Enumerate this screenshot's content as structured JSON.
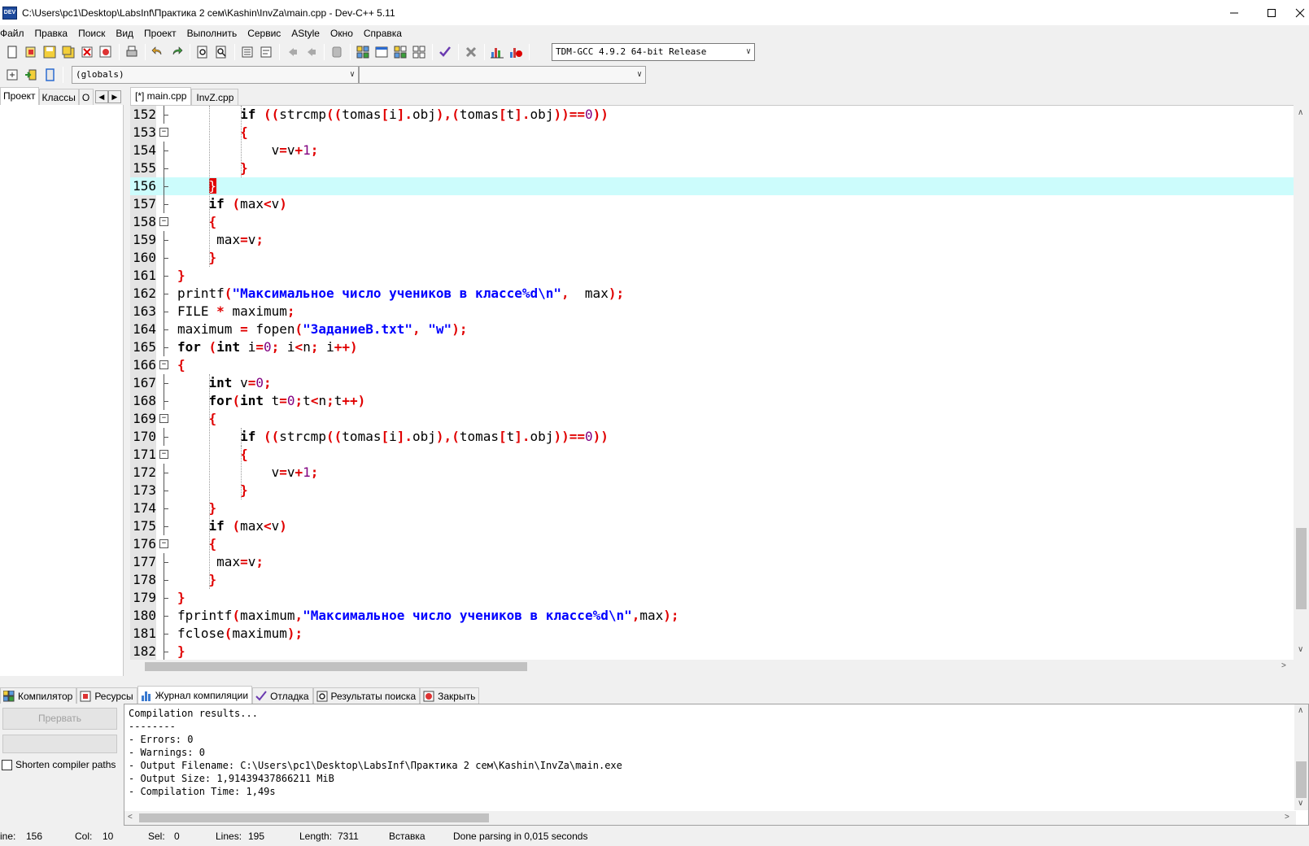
{
  "window": {
    "title": "C:\\Users\\pc1\\Desktop\\LabsInf\\Практика 2 сем\\Kashin\\InvZa\\main.cpp - Dev-C++ 5.11",
    "icon_label": "DEV"
  },
  "menu": [
    "Файл",
    "Правка",
    "Поиск",
    "Вид",
    "Проект",
    "Выполнить",
    "Сервис",
    "AStyle",
    "Окно",
    "Справка"
  ],
  "toolbar": {
    "compiler": "TDM-GCC 4.9.2 64-bit Release",
    "scope_combo": "(globals)",
    "member_combo": ""
  },
  "left_tabs": [
    "Проект",
    "Классы",
    "О"
  ],
  "editor_tabs": [
    "[*] main.cpp",
    "InvZ.cpp"
  ],
  "colors": {
    "keyword": "#000000",
    "symbol": "#e00000",
    "number": "#800080",
    "string": "#0000ff",
    "current_line": "#ccfcfc"
  },
  "code": {
    "current_line": 156,
    "lines": [
      {
        "n": "152",
        "tokens": [
          [
            "ws",
            "        "
          ],
          [
            "kw",
            "if"
          ],
          [
            "ws",
            " "
          ],
          [
            "sym",
            "(("
          ],
          [
            "id",
            "strcmp"
          ],
          [
            "sym",
            "(("
          ],
          [
            "id",
            "tomas"
          ],
          [
            "sym",
            "["
          ],
          [
            "id",
            "i"
          ],
          [
            "sym",
            "]."
          ],
          [
            "id",
            "obj"
          ],
          [
            "sym",
            "),("
          ],
          [
            "id",
            "tomas"
          ],
          [
            "sym",
            "["
          ],
          [
            "id",
            "t"
          ],
          [
            "sym",
            "]."
          ],
          [
            "id",
            "obj"
          ],
          [
            "sym",
            "))=="
          ],
          [
            "num",
            "0"
          ],
          [
            "sym",
            "))"
          ]
        ]
      },
      {
        "n": "153",
        "tokens": [
          [
            "ws",
            "        "
          ],
          [
            "sym",
            "{"
          ]
        ]
      },
      {
        "n": "154",
        "tokens": [
          [
            "ws",
            "            "
          ],
          [
            "id",
            "v"
          ],
          [
            "sym",
            "="
          ],
          [
            "id",
            "v"
          ],
          [
            "sym",
            "+"
          ],
          [
            "num",
            "1"
          ],
          [
            "sym",
            ";"
          ]
        ]
      },
      {
        "n": "155",
        "tokens": [
          [
            "ws",
            "        "
          ],
          [
            "sym",
            "}"
          ]
        ]
      },
      {
        "n": "156",
        "tokens": [
          [
            "ws",
            "    "
          ],
          [
            "caret",
            "}"
          ]
        ]
      },
      {
        "n": "157",
        "tokens": [
          [
            "ws",
            "    "
          ],
          [
            "kw",
            "if"
          ],
          [
            "ws",
            " "
          ],
          [
            "sym",
            "("
          ],
          [
            "id",
            "max"
          ],
          [
            "sym",
            "<"
          ],
          [
            "id",
            "v"
          ],
          [
            "sym",
            ")"
          ]
        ]
      },
      {
        "n": "158",
        "tokens": [
          [
            "ws",
            "    "
          ],
          [
            "sym",
            "{"
          ]
        ]
      },
      {
        "n": "159",
        "tokens": [
          [
            "ws",
            "     "
          ],
          [
            "id",
            "max"
          ],
          [
            "sym",
            "="
          ],
          [
            "id",
            "v"
          ],
          [
            "sym",
            ";"
          ]
        ]
      },
      {
        "n": "160",
        "tokens": [
          [
            "ws",
            "    "
          ],
          [
            "sym",
            "}"
          ]
        ]
      },
      {
        "n": "161",
        "tokens": [
          [
            "sym",
            "}"
          ]
        ]
      },
      {
        "n": "162",
        "tokens": [
          [
            "id",
            "printf"
          ],
          [
            "sym",
            "("
          ],
          [
            "str",
            "\"Максимальное число учеников в классе%d\\n\""
          ],
          [
            "sym",
            ","
          ],
          [
            "id",
            "  max"
          ],
          [
            "sym",
            ");"
          ]
        ]
      },
      {
        "n": "163",
        "tokens": [
          [
            "id",
            "FILE "
          ],
          [
            "sym",
            "*"
          ],
          [
            "id",
            " maximum"
          ],
          [
            "sym",
            ";"
          ]
        ]
      },
      {
        "n": "164",
        "tokens": [
          [
            "id",
            "maximum "
          ],
          [
            "sym",
            "="
          ],
          [
            "id",
            " fopen"
          ],
          [
            "sym",
            "("
          ],
          [
            "str",
            "\"ЗаданиеВ.txt\""
          ],
          [
            "sym",
            ","
          ],
          [
            "id",
            " "
          ],
          [
            "str",
            "\"w\""
          ],
          [
            "sym",
            ");"
          ]
        ]
      },
      {
        "n": "165",
        "tokens": [
          [
            "kw",
            "for"
          ],
          [
            "ws",
            " "
          ],
          [
            "sym",
            "("
          ],
          [
            "kw",
            "int"
          ],
          [
            "id",
            " i"
          ],
          [
            "sym",
            "="
          ],
          [
            "num",
            "0"
          ],
          [
            "sym",
            ";"
          ],
          [
            "id",
            " i"
          ],
          [
            "sym",
            "<"
          ],
          [
            "id",
            "n"
          ],
          [
            "sym",
            ";"
          ],
          [
            "id",
            " i"
          ],
          [
            "sym",
            "++)"
          ]
        ]
      },
      {
        "n": "166",
        "tokens": [
          [
            "sym",
            "{"
          ]
        ]
      },
      {
        "n": "167",
        "tokens": [
          [
            "ws",
            "    "
          ],
          [
            "kw",
            "int"
          ],
          [
            "id",
            " v"
          ],
          [
            "sym",
            "="
          ],
          [
            "num",
            "0"
          ],
          [
            "sym",
            ";"
          ]
        ]
      },
      {
        "n": "168",
        "tokens": [
          [
            "ws",
            "    "
          ],
          [
            "kw",
            "for"
          ],
          [
            "sym",
            "("
          ],
          [
            "kw",
            "int"
          ],
          [
            "id",
            " t"
          ],
          [
            "sym",
            "="
          ],
          [
            "num",
            "0"
          ],
          [
            "sym",
            ";"
          ],
          [
            "id",
            "t"
          ],
          [
            "sym",
            "<"
          ],
          [
            "id",
            "n"
          ],
          [
            "sym",
            ";"
          ],
          [
            "id",
            "t"
          ],
          [
            "sym",
            "++)"
          ]
        ]
      },
      {
        "n": "169",
        "tokens": [
          [
            "ws",
            "    "
          ],
          [
            "sym",
            "{"
          ]
        ]
      },
      {
        "n": "170",
        "tokens": [
          [
            "ws",
            "        "
          ],
          [
            "kw",
            "if"
          ],
          [
            "ws",
            " "
          ],
          [
            "sym",
            "(("
          ],
          [
            "id",
            "strcmp"
          ],
          [
            "sym",
            "(("
          ],
          [
            "id",
            "tomas"
          ],
          [
            "sym",
            "["
          ],
          [
            "id",
            "i"
          ],
          [
            "sym",
            "]."
          ],
          [
            "id",
            "obj"
          ],
          [
            "sym",
            "),("
          ],
          [
            "id",
            "tomas"
          ],
          [
            "sym",
            "["
          ],
          [
            "id",
            "t"
          ],
          [
            "sym",
            "]."
          ],
          [
            "id",
            "obj"
          ],
          [
            "sym",
            "))=="
          ],
          [
            "num",
            "0"
          ],
          [
            "sym",
            "))"
          ]
        ]
      },
      {
        "n": "171",
        "tokens": [
          [
            "ws",
            "        "
          ],
          [
            "sym",
            "{"
          ]
        ]
      },
      {
        "n": "172",
        "tokens": [
          [
            "ws",
            "            "
          ],
          [
            "id",
            "v"
          ],
          [
            "sym",
            "="
          ],
          [
            "id",
            "v"
          ],
          [
            "sym",
            "+"
          ],
          [
            "num",
            "1"
          ],
          [
            "sym",
            ";"
          ]
        ]
      },
      {
        "n": "173",
        "tokens": [
          [
            "ws",
            "        "
          ],
          [
            "sym",
            "}"
          ]
        ]
      },
      {
        "n": "174",
        "tokens": [
          [
            "ws",
            "    "
          ],
          [
            "sym",
            "}"
          ]
        ]
      },
      {
        "n": "175",
        "tokens": [
          [
            "ws",
            "    "
          ],
          [
            "kw",
            "if"
          ],
          [
            "ws",
            " "
          ],
          [
            "sym",
            "("
          ],
          [
            "id",
            "max"
          ],
          [
            "sym",
            "<"
          ],
          [
            "id",
            "v"
          ],
          [
            "sym",
            ")"
          ]
        ]
      },
      {
        "n": "176",
        "tokens": [
          [
            "ws",
            "    "
          ],
          [
            "sym",
            "{"
          ]
        ]
      },
      {
        "n": "177",
        "tokens": [
          [
            "ws",
            "     "
          ],
          [
            "id",
            "max"
          ],
          [
            "sym",
            "="
          ],
          [
            "id",
            "v"
          ],
          [
            "sym",
            ";"
          ]
        ]
      },
      {
        "n": "178",
        "tokens": [
          [
            "ws",
            "    "
          ],
          [
            "sym",
            "}"
          ]
        ]
      },
      {
        "n": "179",
        "tokens": [
          [
            "sym",
            "}"
          ]
        ]
      },
      {
        "n": "180",
        "tokens": [
          [
            "id",
            "fprintf"
          ],
          [
            "sym",
            "("
          ],
          [
            "id",
            "maximum"
          ],
          [
            "sym",
            ","
          ],
          [
            "str",
            "\"Максимальное число учеников в классе%d\\n\""
          ],
          [
            "sym",
            ","
          ],
          [
            "id",
            "max"
          ],
          [
            "sym",
            ");"
          ]
        ]
      },
      {
        "n": "181",
        "tokens": [
          [
            "id",
            "fclose"
          ],
          [
            "sym",
            "("
          ],
          [
            "id",
            "maximum"
          ],
          [
            "sym",
            ");"
          ]
        ]
      },
      {
        "n": "182",
        "tokens": [
          [
            "sym",
            "}"
          ]
        ]
      }
    ]
  },
  "bottom_tabs": [
    "Компилятор",
    "Ресурсы",
    "Журнал компиляции",
    "Отладка",
    "Результаты поиска",
    "Закрыть"
  ],
  "bottom_left": {
    "abort_label": "Прервать",
    "shorten_label": "Shorten compiler paths"
  },
  "log": [
    "Compilation results...",
    "--------",
    "- Errors: 0",
    "- Warnings: 0",
    "- Output Filename: C:\\Users\\pc1\\Desktop\\LabsInf\\Практика 2 сем\\Kashin\\InvZa\\main.exe",
    "- Output Size: 1,91439437866211 MiB",
    "- Compilation Time: 1,49s"
  ],
  "status": {
    "line_label": "ine:",
    "line_value": "156",
    "col_label": "Col:",
    "col_value": "10",
    "sel_label": "Sel:",
    "sel_value": "0",
    "lines_label": "Lines:",
    "lines_value": "195",
    "length_label": "Length:",
    "length_value": "7311",
    "mode": "Вставка",
    "message": "Done parsing in 0,015 seconds"
  }
}
